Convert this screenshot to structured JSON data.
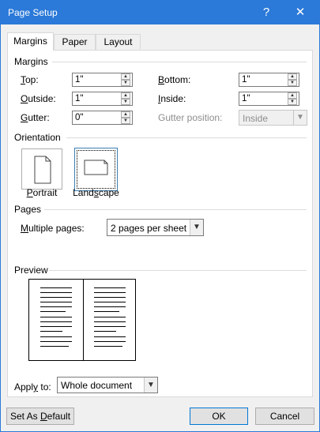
{
  "window": {
    "title": "Page Setup",
    "help_glyph": "?",
    "close_glyph": "✕",
    "accent_color": "#2b79d8"
  },
  "tabs": [
    {
      "label": "Margins",
      "active": true
    },
    {
      "label": "Paper",
      "active": false
    },
    {
      "label": "Layout",
      "active": false
    }
  ],
  "margins": {
    "group_label": "Margins",
    "top": {
      "label_u": "T",
      "label_rest": "op:",
      "value": "1\""
    },
    "bottom": {
      "label_u": "B",
      "label_rest": "ottom:",
      "value": "1\""
    },
    "outside": {
      "label_u": "O",
      "label_rest": "utside:",
      "value": "1\""
    },
    "inside": {
      "label_u": "I",
      "label_rest": "nside:",
      "value": "1\""
    },
    "gutter": {
      "label_u": "G",
      "label_rest": "utter:",
      "value": "0\""
    },
    "gutter_position": {
      "label": "Gutter position:",
      "value": "Inside",
      "disabled": true
    }
  },
  "orientation": {
    "group_label": "Orientation",
    "portrait": {
      "label_u": "P",
      "label_rest": "ortrait",
      "selected": false
    },
    "landscape": {
      "label_pre": "Land",
      "label_u": "s",
      "label_rest": "cape",
      "selected": true
    }
  },
  "pages": {
    "group_label": "Pages",
    "multiple_pages": {
      "label_u": "M",
      "label_rest": "ultiple pages:",
      "value": "2 pages per sheet"
    }
  },
  "preview": {
    "group_label": "Preview"
  },
  "apply_to": {
    "label_pre": "Appl",
    "label_u": "y",
    "label_rest": " to:",
    "value": "Whole document"
  },
  "buttons": {
    "set_default": {
      "label_pre": "Set As ",
      "label_u": "D",
      "label_rest": "efault"
    },
    "ok": "OK",
    "cancel": "Cancel"
  }
}
